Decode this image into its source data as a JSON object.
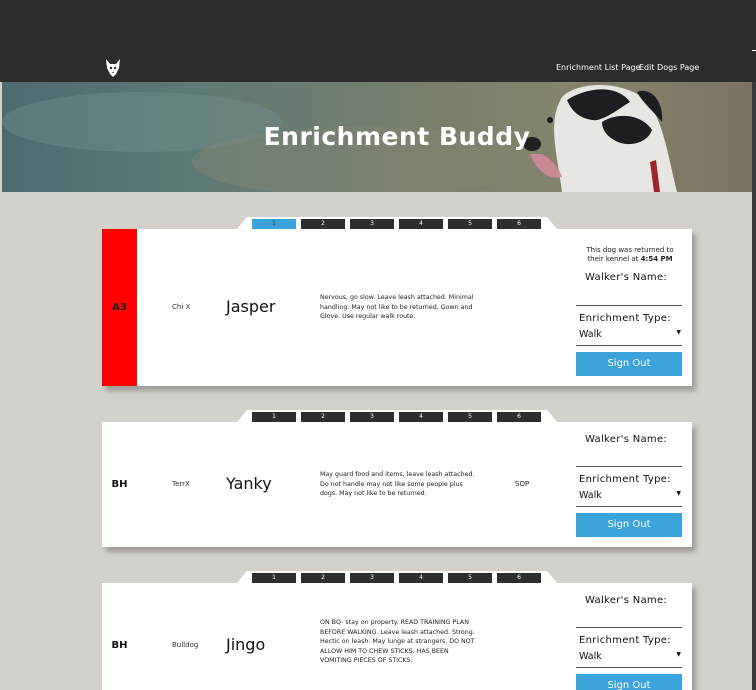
{
  "nav": {
    "links": [
      "Enrichment List Page",
      "Edit Dogs Page"
    ]
  },
  "hero": {
    "title": "Enrichment Buddy"
  },
  "colors": {
    "accent": "#3aa3dc",
    "kennel_alert": "#ff0000",
    "topbar": "#2c2c2c",
    "background": "#d4d0cc"
  },
  "icons": {
    "logo": "dog-logo-icon",
    "dropdown": "caret-down-icon"
  },
  "cards": [
    {
      "tabs": [
        "1",
        "2",
        "3",
        "4",
        "5",
        "6"
      ],
      "active_tab": "1",
      "kennel": "A3",
      "kennel_alert": true,
      "breed": "Chi X",
      "name": "Jasper",
      "notes": "Nervous, go slow. Leave leash attached. Minimal handling. May not like to be returned. Gown and Glove. Use regular walk route.",
      "sop": "",
      "returned_text": "This dog was returned to their kennel at",
      "returned_time": "4:54 PM",
      "walker_label": "Walker's Name:",
      "walker_value": "",
      "type_label": "Enrichment Type:",
      "type_value": "Walk",
      "button": "Sign Out"
    },
    {
      "tabs": [
        "1",
        "2",
        "3",
        "4",
        "5",
        "6"
      ],
      "active_tab": "",
      "kennel": "BH",
      "kennel_alert": false,
      "breed": "TerrX",
      "name": "Yanky",
      "notes": "May guard food and items, leave leash attached. Do not handle may not like some people plus dogs. May not like to be returned.",
      "sop": "SOP",
      "returned_text": "",
      "returned_time": "",
      "walker_label": "Walker's Name:",
      "walker_value": "",
      "type_label": "Enrichment Type:",
      "type_value": "Walk",
      "button": "Sign Out"
    },
    {
      "tabs": [
        "1",
        "2",
        "3",
        "4",
        "5",
        "6"
      ],
      "active_tab": "",
      "kennel": "BH",
      "kennel_alert": false,
      "breed": "Bulldog",
      "name": "Jingo",
      "notes": "ON BQ- stay on property. READ TRAINING PLAN BEFORE WALKING. Leave leash attached. Strong. Hectic on leash. May lunge at strangers. DO NOT ALLOW HIM TO CHEW STICKS. HAS BEEN VOMITING PIECES OF STICKS.",
      "sop": "",
      "returned_text": "",
      "returned_time": "",
      "walker_label": "Walker's Name:",
      "walker_value": "",
      "type_label": "Enrichment Type:",
      "type_value": "Walk",
      "button": "Sign Out"
    }
  ]
}
